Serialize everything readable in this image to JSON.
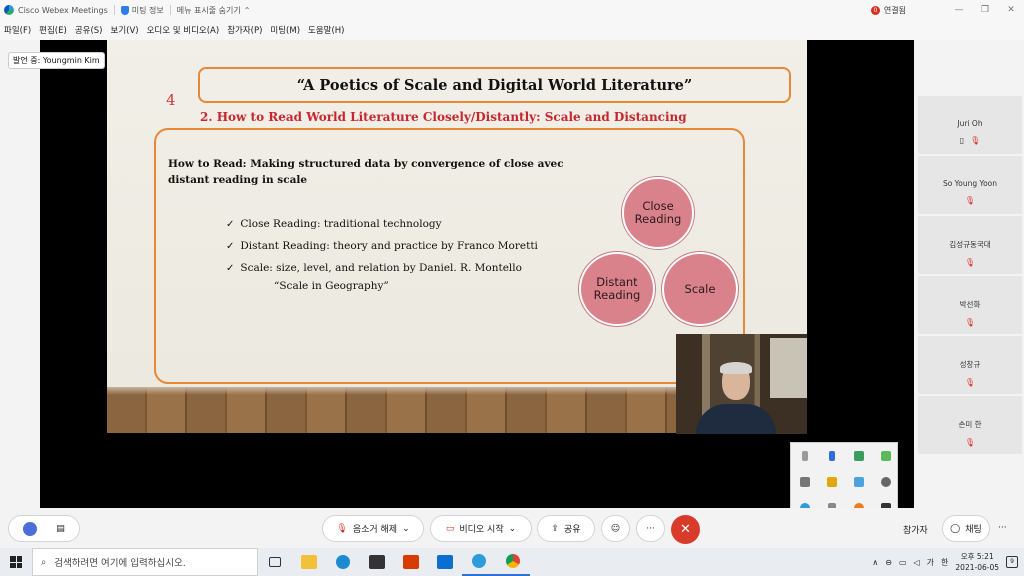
{
  "window": {
    "app_title": "Cisco Webex Meetings",
    "meeting_info": "미팅 정보",
    "hide_menu": "메뉴 표시줄 숨기기",
    "connection_label": "연결됨",
    "connection_badge": "0"
  },
  "menu": [
    "파일(F)",
    "편집(E)",
    "공유(S)",
    "보기(V)",
    "오디오 및 비디오(A)",
    "참가자(P)",
    "미팅(M)",
    "도움말(H)"
  ],
  "speaker_label": "발언 중: Youngmin Kim",
  "slide": {
    "number": "4",
    "title": "“A Poetics of Scale and Digital World Literature”",
    "subtitle": "2. How to Read World Literature Closely/Distantly: Scale and Distancing",
    "how_to_read": "How to Read: Making structured data by convergence of close avec distant reading in scale",
    "bullets": [
      "Close Reading: traditional technology",
      "Distant Reading: theory and practice by Franco Moretti",
      "Scale: size, level, and relation by Daniel. R. Montello"
    ],
    "sub_bullet": "“Scale in Geography”",
    "circles": {
      "close": "Close Reading",
      "distant": "Distant Reading",
      "scale": "Scale"
    }
  },
  "participants": [
    {
      "name": "Juri Oh"
    },
    {
      "name": "So Young Yoon"
    },
    {
      "name": "김성규동국대"
    },
    {
      "name": "박선화"
    },
    {
      "name": "성창규"
    },
    {
      "name": "손미 한"
    }
  ],
  "controls": {
    "mute": "음소거 해제",
    "video": "비디오 시작",
    "share": "공유",
    "participants": "참가자",
    "chat": "채팅"
  },
  "taskbar": {
    "search_placeholder": "검색하려면 여기에 입력하십시오.",
    "ime": "가",
    "lang": "한",
    "time": "오후 5:21",
    "date": "2021-06-05",
    "notif_count": "9"
  }
}
